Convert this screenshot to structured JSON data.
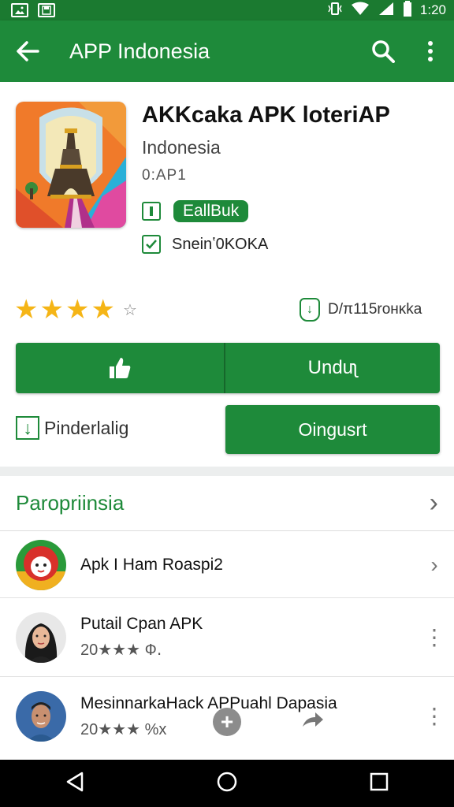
{
  "status_bar": {
    "time": "1:20"
  },
  "app_bar": {
    "title": "APP Indonesia"
  },
  "app": {
    "title": "AKKcaka APK loteriAP",
    "developer": "Indonesia",
    "version": "0:AP1",
    "badge": "EallBuk",
    "sub_label": "Sneinʽ0KOKA",
    "downloads": "D/π115roнκka",
    "rating_stars": 4
  },
  "buttons": {
    "install": "Unduʅ",
    "wishlist": "Pinderlalig",
    "open": "Oingusrt"
  },
  "section": {
    "title": "Paropriinsia"
  },
  "list": [
    {
      "title": "Apk I Ham Roaspi2",
      "sub": ""
    },
    {
      "title": "Putail Cpan APK",
      "sub": "20★★★ Ф․"
    },
    {
      "title": "MesinnarkaHack APPuahl Dapasia",
      "sub": "20★★★ %x"
    }
  ],
  "colors": {
    "primary": "#1e8a3a",
    "status": "#1b7a30",
    "star": "#f5b516"
  }
}
